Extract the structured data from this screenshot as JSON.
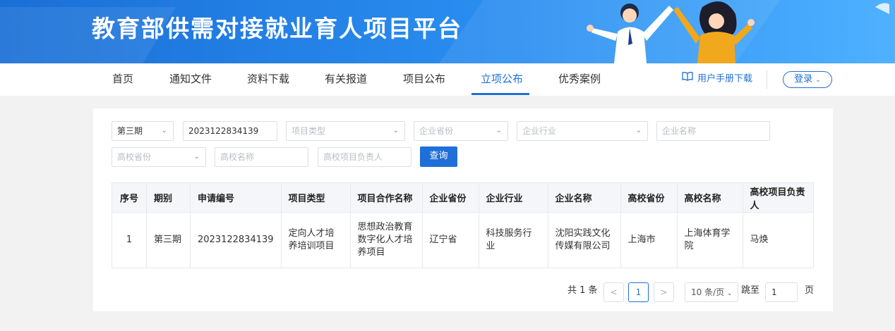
{
  "banner": {
    "title": "教育部供需对接就业育人项目平台"
  },
  "nav": {
    "items": [
      {
        "label": "首页"
      },
      {
        "label": "通知文件"
      },
      {
        "label": "资料下载"
      },
      {
        "label": "有关报道"
      },
      {
        "label": "项目公布"
      },
      {
        "label": "立项公布"
      },
      {
        "label": "优秀案例"
      }
    ],
    "active": "立项公布",
    "manual_label": "用户手册下载",
    "login_label": "登录",
    "accent": "#1f6fd8"
  },
  "filters": {
    "period": {
      "value": "第三期"
    },
    "application_no": {
      "value": "2023122834139"
    },
    "project_type": {
      "placeholder": "项目类型"
    },
    "company_province": {
      "placeholder": "企业省份"
    },
    "company_industry": {
      "placeholder": "企业行业"
    },
    "company_name": {
      "placeholder": "企业名称"
    },
    "school_province": {
      "placeholder": "高校省份"
    },
    "school_name": {
      "placeholder": "高校名称"
    },
    "school_leader": {
      "placeholder": "高校项目负责人"
    },
    "query_label": "查询"
  },
  "table": {
    "headers": [
      "序号",
      "期别",
      "申请编号",
      "项目类型",
      "项目合作名称",
      "企业省份",
      "企业行业",
      "企业名称",
      "高校省份",
      "高校名称",
      "高校项目负责人"
    ],
    "rows": [
      [
        "1",
        "第三期",
        "2023122834139",
        "定向人才培养培训项目",
        "思想政治教育数字化人才培养项目",
        "辽宁省",
        "科技服务行业",
        "沈阳实践文化传媒有限公司",
        "上海市",
        "上海体育学院",
        "马焕"
      ]
    ]
  },
  "pagination": {
    "total_label": "共 1 条",
    "prev": "<",
    "current_page": "1",
    "next": ">",
    "page_size": "10 条/页",
    "jump_label": "跳至",
    "jump_value": "1",
    "page_suffix": "页"
  }
}
